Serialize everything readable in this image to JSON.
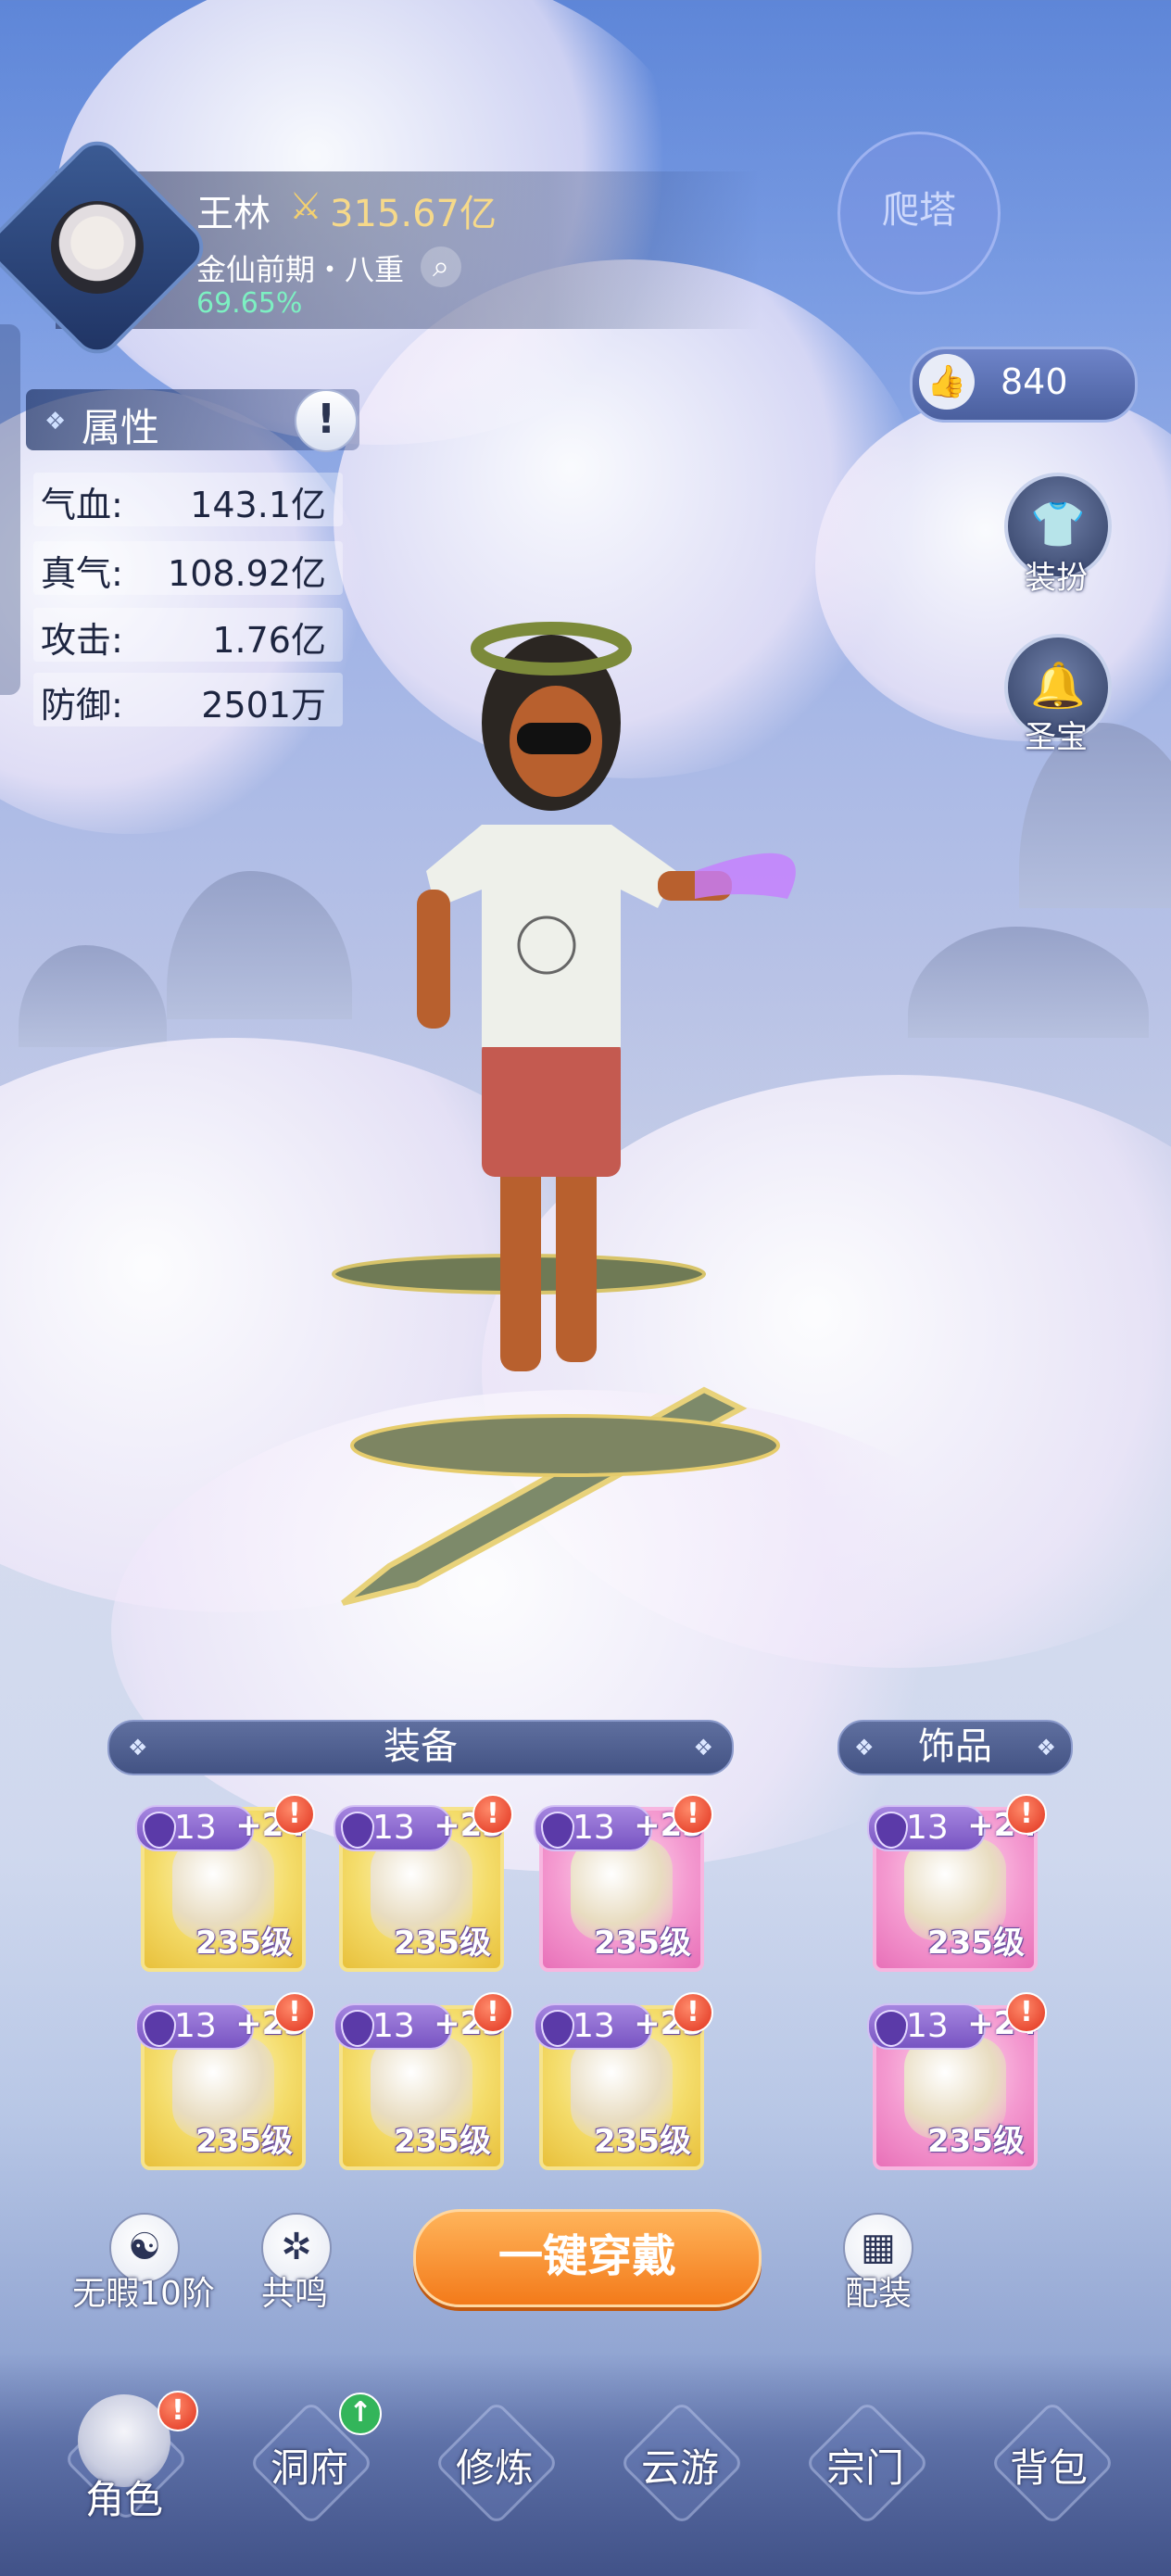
{
  "player": {
    "name": "王林",
    "power_icon": "crossed-swords-icon",
    "power": "315.67亿",
    "realm": "金仙前期・八重",
    "exp_percent": "69.65%"
  },
  "tower_button": {
    "label": "爬塔"
  },
  "attributes": {
    "title": "属性",
    "info_glyph": "!",
    "rows": [
      {
        "label": "气血:",
        "value": "143.1亿"
      },
      {
        "label": "真气:",
        "value": "108.92亿"
      },
      {
        "label": "攻击:",
        "value": "1.76亿"
      },
      {
        "label": "防御:",
        "value": "2501万"
      }
    ]
  },
  "likes": {
    "count": "840"
  },
  "side_buttons": [
    {
      "label": "装扮",
      "icon": "shirt-icon"
    },
    {
      "label": "圣宝",
      "icon": "bell-icon"
    }
  ],
  "equipment": {
    "title": "装备",
    "slots": [
      {
        "tier": "13",
        "plus": "+24",
        "level": "235级",
        "rarity": "gold",
        "alert": "!"
      },
      {
        "tier": "13",
        "plus": "+23",
        "level": "235级",
        "rarity": "gold",
        "alert": "!"
      },
      {
        "tier": "13",
        "plus": "+23",
        "level": "235级",
        "rarity": "pink",
        "alert": "!"
      },
      {
        "tier": "13",
        "plus": "+23",
        "level": "235级",
        "rarity": "gold",
        "alert": "!"
      },
      {
        "tier": "13",
        "plus": "+23",
        "level": "235级",
        "rarity": "gold",
        "alert": "!"
      },
      {
        "tier": "13",
        "plus": "+23",
        "level": "235级",
        "rarity": "gold",
        "alert": "!"
      }
    ]
  },
  "accessories": {
    "title": "饰品",
    "slots": [
      {
        "tier": "13",
        "plus": "+24",
        "level": "235级",
        "rarity": "pink",
        "alert": "!"
      },
      {
        "tier": "13",
        "plus": "+24",
        "level": "235级",
        "rarity": "pink",
        "alert": "!"
      }
    ]
  },
  "actions": {
    "flawless": "无暇10阶",
    "resonance": "共鸣",
    "one_key_equip": "一键穿戴",
    "loadout": "配装"
  },
  "nav": {
    "alert": "!",
    "up_arrow": "↑",
    "items": [
      {
        "label": "角色",
        "active": true
      },
      {
        "label": "洞府"
      },
      {
        "label": "修炼"
      },
      {
        "label": "云游"
      },
      {
        "label": "宗门"
      },
      {
        "label": "背包"
      }
    ]
  }
}
